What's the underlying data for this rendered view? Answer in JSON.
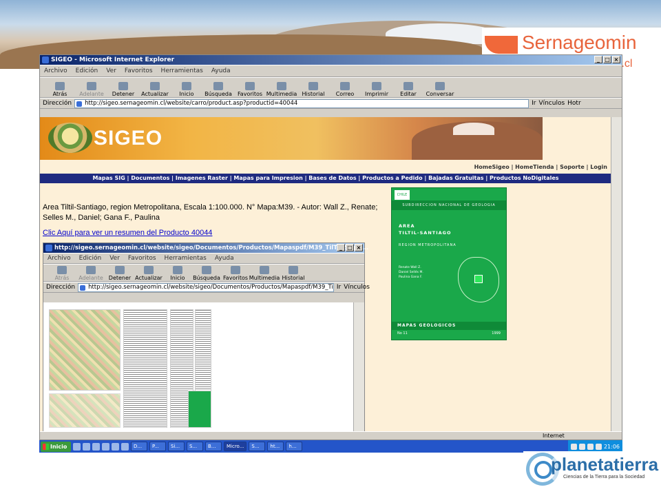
{
  "slide": {
    "brand_top": "Sernageomin",
    "brand_top_sub": "in.cl",
    "brand_bottom": "planetatierra",
    "brand_bottom_tagline": "Ciencias de la Tierra para la Sociedad"
  },
  "browser": {
    "title": "SIGEO - Microsoft Internet Explorer",
    "menu": [
      "Archivo",
      "Edición",
      "Ver",
      "Favoritos",
      "Herramientas",
      "Ayuda"
    ],
    "toolbar": [
      {
        "label": "Atrás",
        "icon": "back-icon"
      },
      {
        "label": "Adelante",
        "icon": "forward-icon"
      },
      {
        "label": "Detener",
        "icon": "stop-icon"
      },
      {
        "label": "Actualizar",
        "icon": "refresh-icon"
      },
      {
        "label": "Inicio",
        "icon": "home-icon"
      },
      {
        "label": "Búsqueda",
        "icon": "search-icon"
      },
      {
        "label": "Favoritos",
        "icon": "favorites-icon"
      },
      {
        "label": "Multimedia",
        "icon": "media-icon"
      },
      {
        "label": "Historial",
        "icon": "history-icon"
      },
      {
        "label": "Correo",
        "icon": "mail-icon"
      },
      {
        "label": "Imprimir",
        "icon": "print-icon"
      },
      {
        "label": "Editar",
        "icon": "edit-icon"
      },
      {
        "label": "Conversar",
        "icon": "discuss-icon"
      }
    ],
    "address_label": "Dirección",
    "address_value": "http://sigeo.sernageomin.cl/website/carro/product.asp?productid=40044",
    "go_label": "Ir",
    "links_label": "Vínculos",
    "links_item": "Hotr",
    "status_zone": "Internet"
  },
  "page": {
    "logo_text": "SIGEO",
    "top_links": "HomeSigeo | HomeTienda | Soporte | Login",
    "nav": "Mapas SIG | Documentos | Imagenes Raster | Mapas para Impresion | Bases de Datos | Productos a Pedido | Bajadas Gratuitas | Productos NoDigitales",
    "product_description": "Area Tiltil-Santiago, region Metropolitana, Escala 1:100.000. N° Mapa:M39. - Autor: Wall Z., Renate; Selles M., Daniel; Gana F., Paulina",
    "summary_link": "Clic Aquí para ver un resumen del Producto 40044",
    "cover": {
      "header": "SUBDIRECCION NACIONAL DE GEOLOGIA",
      "title_line1": "AREA",
      "title_line2": "TILTIL-SANTIAGO",
      "region": "REGION METROPOLITANA",
      "authors": "Renate Wall Z.\nDaniel Sellés M.\nPaulina Gana F.",
      "footer": "MAPAS GEOLOGICOS",
      "number": "No 11",
      "year": "1999"
    }
  },
  "inner_browser": {
    "title": "http://sigeo.sernageomin.cl/website/sigeo/Documentos/Productos/Mapaspdf/M39_TilTil_Stgo....",
    "menu": [
      "Archivo",
      "Edición",
      "Ver",
      "Favoritos",
      "Herramientas",
      "Ayuda"
    ],
    "toolbar": [
      {
        "label": "Atrás",
        "icon": "back-icon"
      },
      {
        "label": "Adelante",
        "icon": "forward-icon"
      },
      {
        "label": "Detener",
        "icon": "stop-icon"
      },
      {
        "label": "Actualizar",
        "icon": "refresh-icon"
      },
      {
        "label": "Inicio",
        "icon": "home-icon"
      },
      {
        "label": "Búsqueda",
        "icon": "search-icon"
      },
      {
        "label": "Favoritos",
        "icon": "favorites-icon"
      },
      {
        "label": "Multimedia",
        "icon": "media-icon"
      },
      {
        "label": "Historial",
        "icon": "history-icon"
      }
    ],
    "address_label": "Dirección",
    "address_value": "http://sigeo.sernageomin.cl/website/sigeo/Documentos/Productos/Mapaspdf/M39_Ti",
    "go_label": "Ir",
    "links_label": "Vínculos"
  },
  "taskbar": {
    "start": "Inicio",
    "tasks": [
      "D...",
      "P...",
      "Si...",
      "S...",
      "B...",
      "Micro...",
      "S...",
      "ht...",
      "h..."
    ],
    "clock": "21:06"
  },
  "colors": {
    "navbar": "#1f2b80",
    "page_bg": "#fdf0d8",
    "cover_green": "#1aa84a",
    "link": "#0000cc",
    "sernageomin_orange": "#e8643c"
  }
}
